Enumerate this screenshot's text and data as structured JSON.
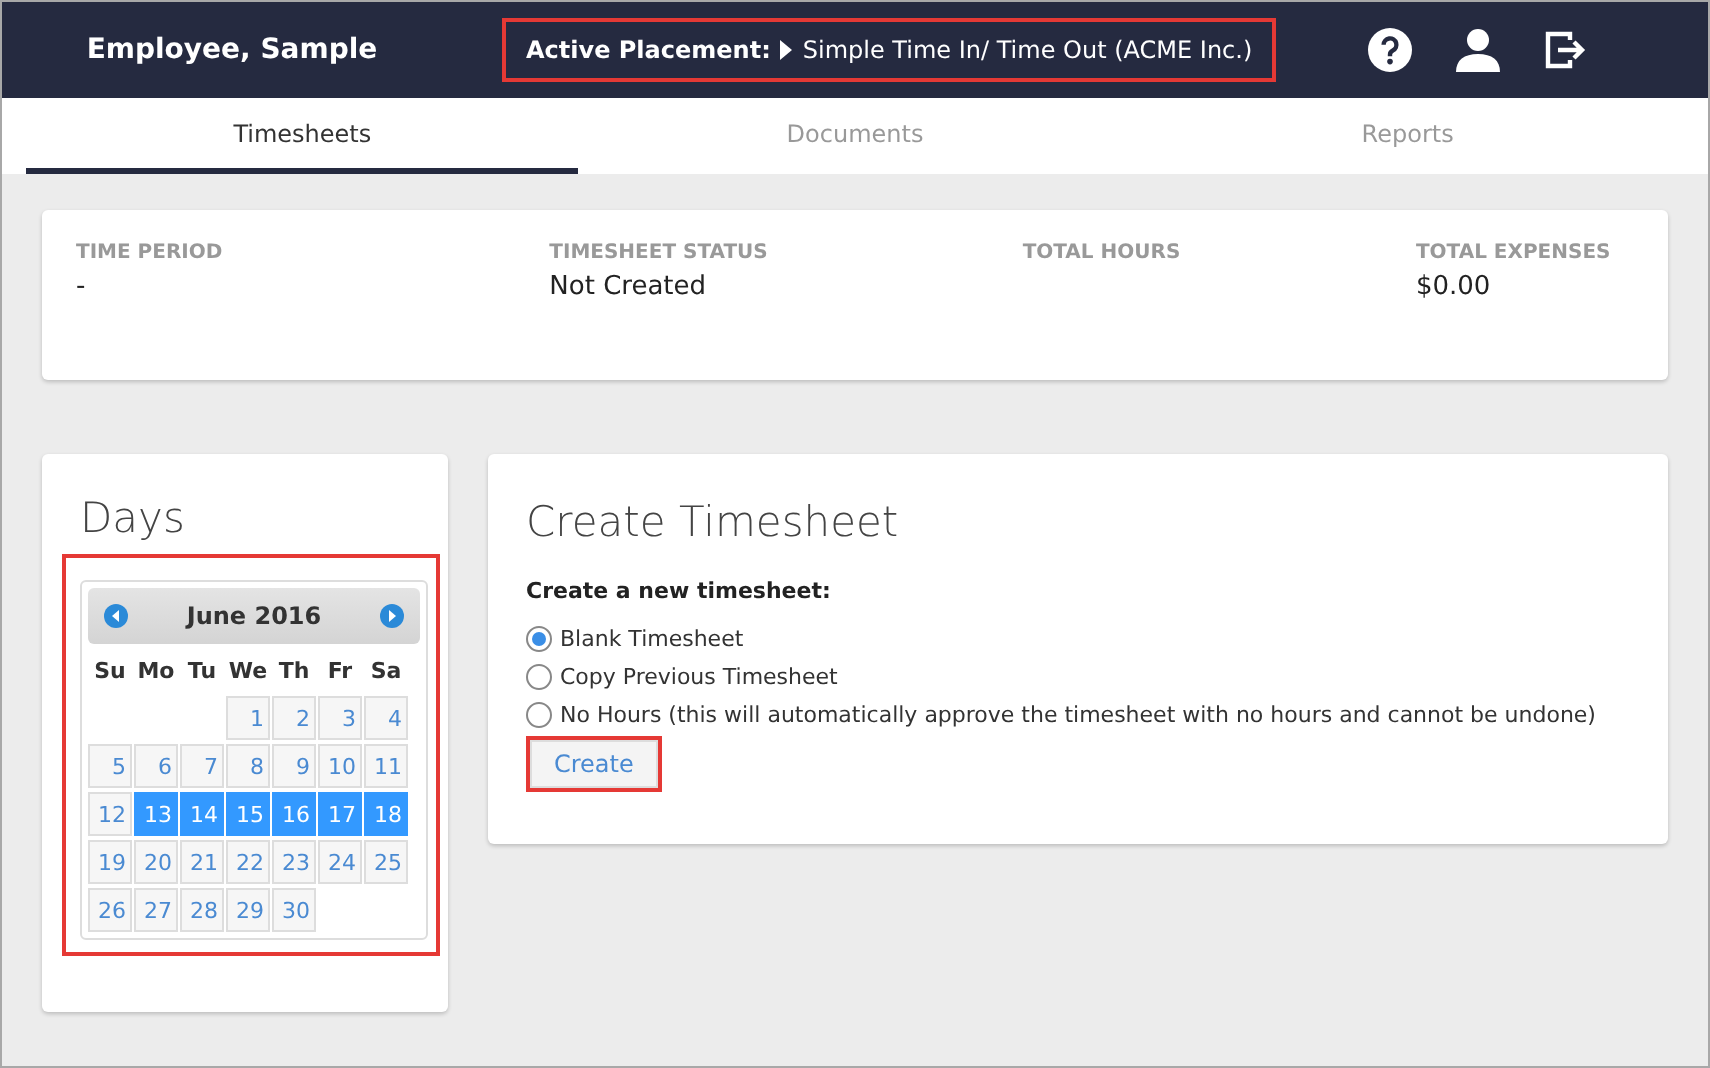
{
  "header": {
    "user": "Employee, Sample",
    "placement_label": "Active Placement:",
    "placement_value": "Simple Time In/ Time Out (ACME Inc.)",
    "highlighted": true
  },
  "tabs": [
    {
      "label": "Timesheets",
      "selected": true
    },
    {
      "label": "Documents",
      "selected": false
    },
    {
      "label": "Reports",
      "selected": false
    }
  ],
  "summary": [
    {
      "label": "TIME PERIOD",
      "value": "-"
    },
    {
      "label": "TIMESHEET STATUS",
      "value": "Not Created"
    },
    {
      "label": "TOTAL HOURS"
    },
    {
      "label": "TOTAL EXPENSES",
      "value": "$0.00"
    }
  ],
  "days": {
    "title": "Days",
    "highlighted": true,
    "month": "June 2016",
    "weekdays": [
      "Su",
      "Mo",
      "Tu",
      "We",
      "Th",
      "Fr",
      "Sa"
    ],
    "weeks": [
      [
        {
          "kind": "blank"
        },
        {
          "kind": "blank"
        },
        {
          "kind": "blank"
        },
        {
          "day": "1",
          "selected": false
        },
        {
          "day": "2",
          "selected": false
        },
        {
          "day": "3",
          "selected": false
        },
        {
          "day": "4",
          "selected": false
        }
      ],
      [
        {
          "day": "5",
          "selected": false
        },
        {
          "day": "6",
          "selected": false
        },
        {
          "day": "7",
          "selected": false
        },
        {
          "day": "8",
          "selected": false
        },
        {
          "day": "9",
          "selected": false
        },
        {
          "day": "10",
          "selected": false
        },
        {
          "day": "11",
          "selected": false
        }
      ],
      [
        {
          "day": "12",
          "selected": false
        },
        {
          "day": "13",
          "selected": true
        },
        {
          "day": "14",
          "selected": true
        },
        {
          "day": "15",
          "selected": true
        },
        {
          "day": "16",
          "selected": true
        },
        {
          "day": "17",
          "selected": true
        },
        {
          "day": "18",
          "selected": true
        }
      ],
      [
        {
          "day": "19",
          "selected": false
        },
        {
          "day": "20",
          "selected": false
        },
        {
          "day": "21",
          "selected": false
        },
        {
          "day": "22",
          "selected": false
        },
        {
          "day": "23",
          "selected": false
        },
        {
          "day": "24",
          "selected": false
        },
        {
          "day": "25",
          "selected": false
        }
      ],
      [
        {
          "day": "26",
          "selected": false
        },
        {
          "day": "27",
          "selected": false
        },
        {
          "day": "28",
          "selected": false
        },
        {
          "day": "29",
          "selected": false
        },
        {
          "day": "30",
          "selected": false
        },
        {
          "kind": "blank"
        },
        {
          "kind": "blank"
        }
      ]
    ]
  },
  "create": {
    "title": "Create Timesheet",
    "prompt": "Create a new timesheet:",
    "options": [
      {
        "label": "Blank Timesheet",
        "selected": true
      },
      {
        "label": "Copy Previous Timesheet",
        "selected": false
      },
      {
        "label": "No Hours (this will automatically approve the timesheet with no hours and cannot be undone)",
        "selected": false
      }
    ],
    "button": "Create",
    "button_highlighted": true
  }
}
